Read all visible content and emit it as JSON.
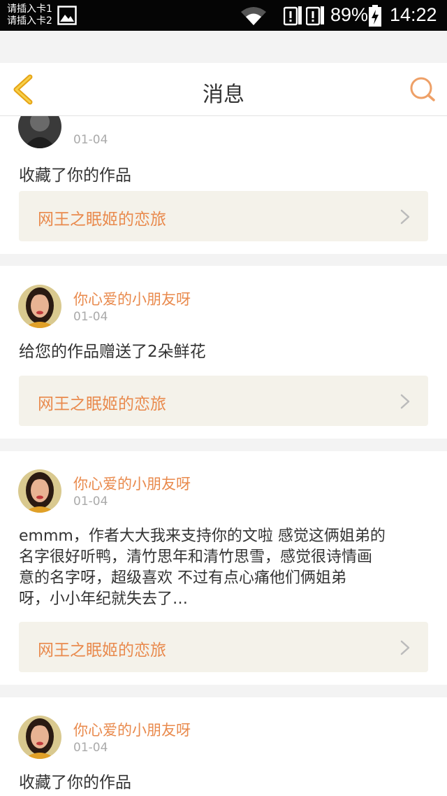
{
  "status_bar": {
    "sim1": "请插入卡1",
    "sim2": "请插入卡2",
    "battery": "89%",
    "time": "14:22"
  },
  "nav": {
    "title": "消息"
  },
  "messages": [
    {
      "username": "",
      "date": "01-04",
      "text": "收藏了你的作品",
      "work_title": "网王之眠姬的恋旅"
    },
    {
      "username": "你心爱的小朋友呀",
      "date": "01-04",
      "text": "给您的作品赠送了2朵鲜花",
      "work_title": "网王之眠姬的恋旅"
    },
    {
      "username": "你心爱的小朋友呀",
      "date": "01-04",
      "text_lines": [
        "emmm，作者大大我来支持你的文啦 感觉这俩姐弟的",
        "名字很好听鸭，清竹思年和清竹思雪，感觉很诗情画",
        "意的名字呀，超级喜欢 不过有点心痛他们俩姐弟",
        "呀，小小年纪就失去了…"
      ],
      "work_title": "网王之眠姬的恋旅"
    },
    {
      "username": "你心爱的小朋友呀",
      "date": "01-04",
      "text": "收藏了你的作品"
    }
  ],
  "colors": {
    "accent": "#e98a4d",
    "back_arrow": "#f0b020",
    "link_bg": "#f4f2ea"
  }
}
